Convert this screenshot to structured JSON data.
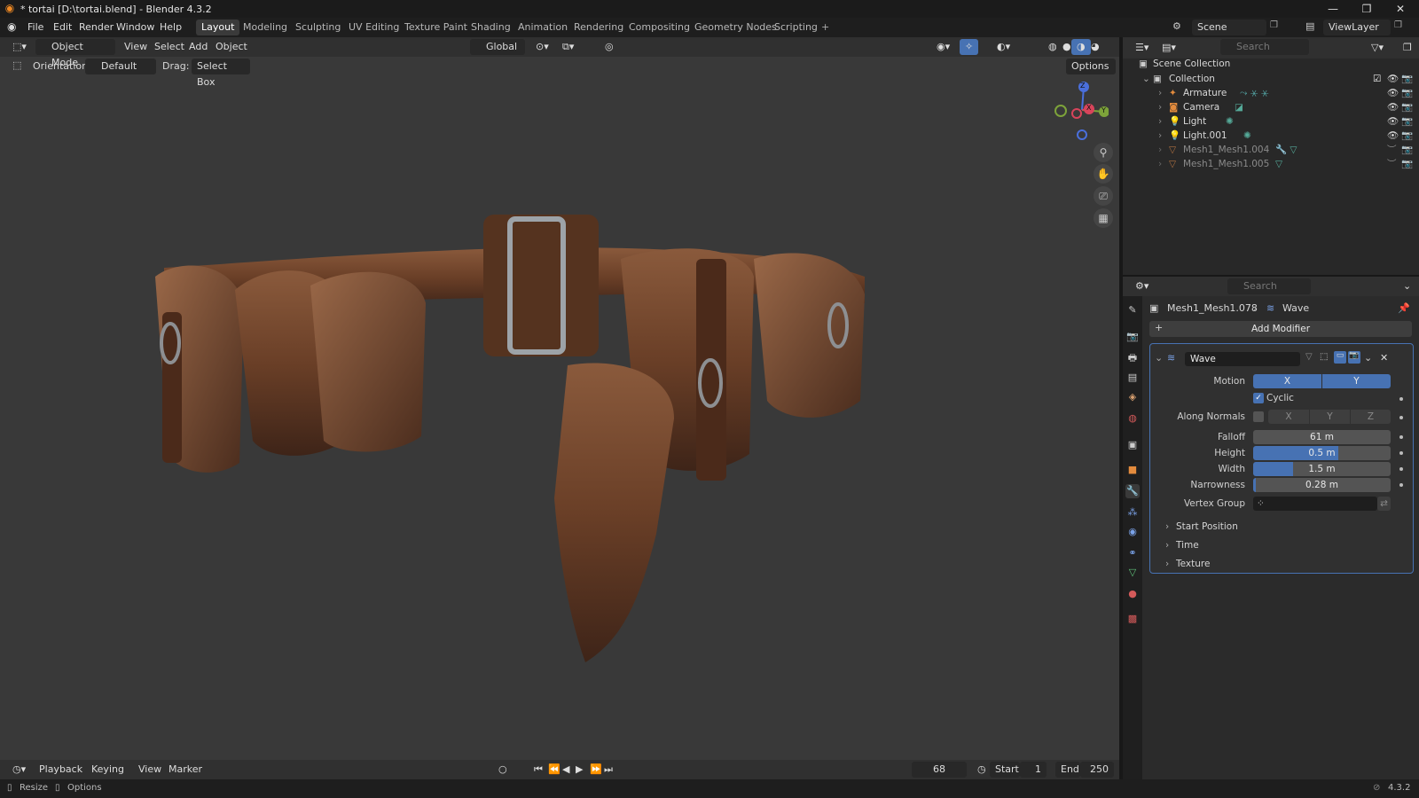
{
  "window": {
    "title": "* tortai [D:\\tortai.blend] - Blender 4.3.2"
  },
  "menu": [
    "File",
    "Edit",
    "Render",
    "Window",
    "Help"
  ],
  "workspaces": [
    "Layout",
    "Modeling",
    "Sculpting",
    "UV Editing",
    "Texture Paint",
    "Shading",
    "Animation",
    "Rendering",
    "Compositing",
    "Geometry Nodes",
    "Scripting"
  ],
  "scene": {
    "name": "Scene",
    "view_layer": "ViewLayer"
  },
  "viewport": {
    "mode": "Object Mode",
    "menus": [
      "View",
      "Select",
      "Add",
      "Object"
    ],
    "transform_space": "Global",
    "orientation_label": "Orientation:",
    "orientation_value": "Default",
    "drag_label": "Drag:",
    "drag_value": "Select Box",
    "options_label": "Options",
    "gizmo_axes": {
      "x": "X",
      "y": "Y",
      "z": "Z"
    }
  },
  "outliner": {
    "search_placeholder": "Search",
    "root": "Scene Collection",
    "collection": "Collection",
    "items": [
      {
        "name": "Armature",
        "color": "#e38b3d"
      },
      {
        "name": "Camera",
        "color": "#e38b3d"
      },
      {
        "name": "Light",
        "color": "#e38b3d"
      },
      {
        "name": "Light.001",
        "color": "#e38b3d"
      },
      {
        "name": "Mesh1_Mesh1.004",
        "color": "#e38b3d"
      },
      {
        "name": "Mesh1_Mesh1.005",
        "color": "#e38b3d"
      }
    ]
  },
  "properties": {
    "search_placeholder": "Search",
    "object_name": "Mesh1_Mesh1.078",
    "modifier_crumb": "Wave",
    "add_modifier": "Add Modifier",
    "modifier": {
      "name": "Wave",
      "motion_label": "Motion",
      "motion_x": "X",
      "motion_y": "Y",
      "cyclic_label": "Cyclic",
      "cyclic_checked": true,
      "along_normals_label": "Along Normals",
      "along_normals_axes": [
        "X",
        "Y",
        "Z"
      ],
      "falloff_label": "Falloff",
      "falloff_value": "61 m",
      "height_label": "Height",
      "height_value": "0.5 m",
      "width_label": "Width",
      "width_value": "1.5 m",
      "narrowness_label": "Narrowness",
      "narrowness_value": "0.28 m",
      "vertex_group_label": "Vertex Group",
      "subpanels": [
        "Start Position",
        "Time",
        "Texture"
      ]
    }
  },
  "timeline": {
    "menus": [
      "Playback",
      "Keying",
      "View",
      "Marker"
    ],
    "current_frame": "68",
    "start_label": "Start",
    "start_value": "1",
    "end_label": "End",
    "end_value": "250"
  },
  "statusbar": {
    "left": [
      "Resize",
      "Options"
    ],
    "version": "4.3.2"
  },
  "colors": {
    "accent": "#4772b3",
    "panel_border": "#4772b3"
  }
}
